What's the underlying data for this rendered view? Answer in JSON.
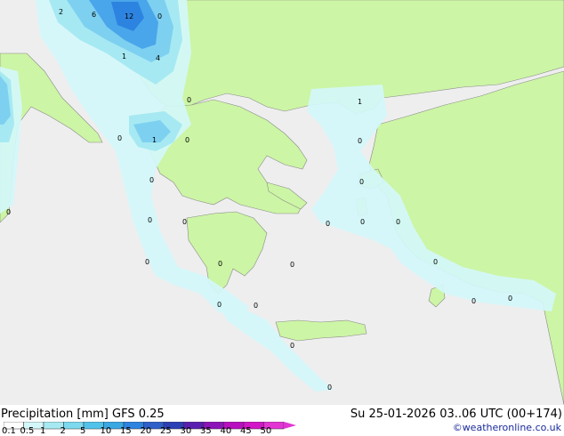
{
  "title": "Precipitation [mm]",
  "model": "GFS 0.25",
  "run": "Su 25-01-2026 03..06 UTC (00+174)",
  "credit": "©weatheronline.co.uk",
  "colors": {
    "sea_land_bg": "#eeeeee",
    "land_green": "#ccf5a5",
    "precip_light": "#d4f7fa",
    "precip_mid": "#a6e9f2",
    "precip_blue": "#7dd0f0",
    "precip_strong": "#4aa6ea",
    "precip_heavy": "#2d83e0"
  },
  "legend": {
    "labels": [
      "0.1",
      "0.5",
      "1",
      "2",
      "5",
      "10",
      "15",
      "20",
      "25",
      "30",
      "35",
      "40",
      "45",
      "50"
    ],
    "colors": [
      "#ffffff",
      "#d4f7fa",
      "#a6e9f2",
      "#7dd9ee",
      "#51c3ea",
      "#39a8e3",
      "#2d83e0",
      "#2f5fc9",
      "#2d3fb5",
      "#5a1fb0",
      "#8c14b8",
      "#b80fc0",
      "#d215c8",
      "#e235d4"
    ]
  },
  "map_labels": [
    "2",
    "6",
    "12",
    "0",
    "1",
    "4",
    "0",
    "1",
    "0",
    "1",
    "0",
    "0",
    "0",
    "0",
    "0",
    "0",
    "0",
    "0",
    "0",
    "0",
    "0",
    "0",
    "0",
    "0",
    "0",
    "0",
    "0",
    "0",
    "0",
    "0",
    "0"
  ]
}
